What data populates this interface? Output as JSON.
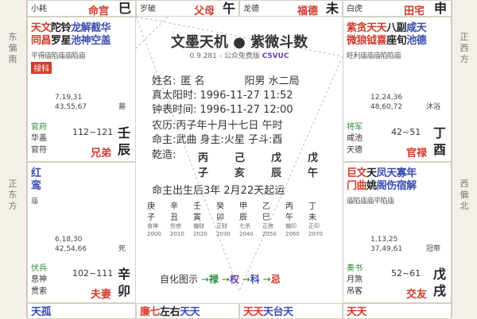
{
  "sides": {
    "left_top": "东偏南",
    "left_mid": "正东方",
    "right_top": "正西方",
    "right_mid": "西偏北"
  },
  "top_row": [
    {
      "god": "小耗",
      "palace": "命宫",
      "branch": "巳"
    },
    {
      "god": "岁破",
      "palace": "父母",
      "branch": "午"
    },
    {
      "god": "龙德",
      "palace": "福德",
      "branch": "未"
    },
    {
      "god": "白虎",
      "palace": "田宅",
      "branch": "申"
    }
  ],
  "left_upper": {
    "stars_line1": [
      "天",
      "文",
      "陀",
      "铃",
      "龙",
      "解",
      "截",
      "华"
    ],
    "stars_line2": [
      "同",
      "昌",
      "罗",
      "星",
      "池",
      "神",
      "空",
      "盖"
    ],
    "brightness": "平得庙陷庙庙陷庙",
    "hua": "禄科",
    "nums1": "7,19,31",
    "nums2": "43,55,67",
    "stage": "墓",
    "sj1": "官府",
    "sj2": "华盖",
    "sj3": "官符",
    "range": "112~121",
    "palace": "兄弟",
    "branch_top": "壬",
    "branch": "辰"
  },
  "right_upper": {
    "stars_line1": [
      "紫",
      "贪",
      "天",
      "天",
      "八",
      "副",
      "咸",
      "天"
    ],
    "stars_line2": [
      "微",
      "狼",
      "钺",
      "喜",
      "座",
      "旬",
      "池",
      "德"
    ],
    "brightness": "旺利庙庙庙陷陷庙",
    "nums1": "12,24,36",
    "nums2": "48,60,72",
    "stage": "沐浴",
    "sj1": "将军",
    "sj2": "咸池",
    "sj3": "天德",
    "range": "42~51",
    "palace": "官禄",
    "branch_top": "丁",
    "branch": "酉"
  },
  "left_lower": {
    "stars_line1": [
      "红"
    ],
    "stars_line2": [
      "鸾"
    ],
    "brightness": "庙",
    "nums1": "6,18,30",
    "nums2": "42,54,66",
    "stage": "死",
    "sj1": "伏兵",
    "sj2": "息神",
    "sj3": "贯索",
    "range": "102~111",
    "palace": "夫妻",
    "branch_top": "辛",
    "branch": "卯"
  },
  "right_lower": {
    "stars_line1": [
      "巨",
      "文",
      "天",
      "凤",
      "天",
      "寡",
      "年"
    ],
    "stars_line2": [
      "门",
      "曲",
      "姚",
      "阁",
      "伤",
      "宿",
      "解"
    ],
    "brightness": "庙陷庙庙平陷庙",
    "nums1": "1,13,25",
    "nums2": "37,49,61",
    "stage": "冠带",
    "sj1": "奏书",
    "sj2": "月煞",
    "sj3": "吊客",
    "range": "52~61",
    "palace": "交友",
    "branch_top": "戊",
    "branch": "戌"
  },
  "bottom_row": [
    [
      "天",
      "孤"
    ],
    [
      "廉",
      "七",
      "左",
      "右",
      "天",
      "天"
    ],
    [
      "天",
      "天",
      "天",
      "台",
      "天"
    ],
    [
      "天",
      "天"
    ]
  ],
  "center": {
    "title": "文墨天机 ● 紫微斗数",
    "version": "0.9.281 - 公众免费版",
    "watermark": "C5VUC",
    "name_label": "姓名:",
    "name_value": "匿 名",
    "gender_ju": "阳男 水二局",
    "true_solar_label": "真太阳时:",
    "true_solar": "1996-11-27 11:52",
    "clock_label": "钟表时间:",
    "clock": "1996-11-27 12:00",
    "lunar_label": "农历:",
    "lunar": "丙子年十月十七日 午时",
    "ming_label": "命主:",
    "ming": "武曲 身主:火星 子斗:酉",
    "qianzao_label": "乾造:",
    "gan": [
      "丙",
      "己",
      "戊",
      "戊"
    ],
    "zhi": [
      "子",
      "亥",
      "辰",
      "午"
    ],
    "yun_line": "命主出生后3年 2月22天起运",
    "dayun_gan": [
      "庚",
      "辛",
      "壬",
      "癸",
      "甲",
      "乙",
      "丙",
      "丁"
    ],
    "dayun_zhi": [
      "子",
      "丑",
      "寅",
      "卯",
      "辰",
      "巳",
      "午",
      "未"
    ],
    "dayun_god": [
      "食神",
      "伤官",
      "偏财",
      "正财",
      "七杀",
      "正官",
      "偏印",
      "正印"
    ],
    "dayun_year": [
      "2000",
      "2010",
      "2020",
      "2030",
      "2040",
      "2050",
      "2060",
      "2070"
    ],
    "legend_label": "自化图示",
    "legend_items": [
      "禄",
      "权",
      "科",
      "忌"
    ],
    "legend_arrow": "→"
  }
}
